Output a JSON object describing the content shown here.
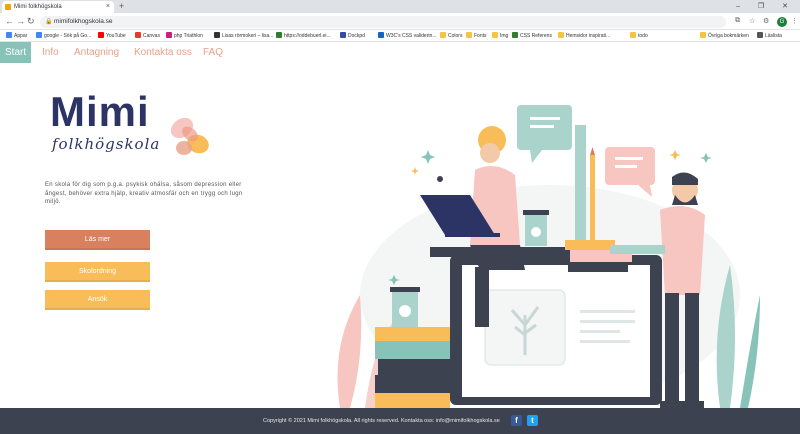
{
  "browser": {
    "tab_title": "Mimi folkhögskola",
    "tab_close": "×",
    "new_tab": "+",
    "window_controls": "– ❐ ✕",
    "url": "mimifolkhogskola.se",
    "profile_initial": "G",
    "bookmarks": [
      {
        "label": "Appar",
        "color": "#4285f4"
      },
      {
        "label": "google - Sök på Go...",
        "color": "#4285f4"
      },
      {
        "label": "YouTube",
        "color": "#ff0000"
      },
      {
        "label": "Canvas",
        "color": "#e13f2b"
      },
      {
        "label": "php Triathlon",
        "color": "#c4227d"
      },
      {
        "label": "Lisas rörmokeri – lisa...",
        "color": "#333333"
      },
      {
        "label": "https://oddebuerl.ei...",
        "color": "#2e7d32"
      },
      {
        "label": "Dockpd",
        "color": "#3949ab"
      },
      {
        "label": "W3C's CSS validerin...",
        "color": "#1565c0"
      },
      {
        "label": "Colors",
        "color": "#f6c343"
      },
      {
        "label": "Fonts",
        "color": "#f6c343"
      },
      {
        "label": "Img",
        "color": "#f6c343"
      },
      {
        "label": "CSS Referens",
        "color": "#2e7d32"
      },
      {
        "label": "Hemsidor inspirati...",
        "color": "#f6c343"
      },
      {
        "label": "todo",
        "color": "#f6c343"
      },
      {
        "label": "Övriga bokmärken",
        "color": "#f6c343"
      },
      {
        "label": "Läslista",
        "color": "#555555"
      }
    ]
  },
  "nav": {
    "items": [
      "Start",
      "Info",
      "Antagning",
      "Kontakta oss",
      "FAQ"
    ]
  },
  "logo": {
    "title": "Mimi",
    "subtitle": "folkhögskola"
  },
  "intro": {
    "text": "En skola för dig som p.g.a. psykisk ohälsa, såsom depression eller ångest, behöver extra hjälp, kreativ atmosfär och en trygg och lugn miljö."
  },
  "buttons": {
    "read_more": "Läs mer",
    "school_rules": "Skolordning",
    "apply": "Ansök"
  },
  "footer": {
    "text": "Copyright © 2021 Mimi folkhögskola. All rights reserved. Kontakta oss: info@mimifolkhogskola.se",
    "facebook": "f",
    "twitter": "t"
  },
  "colors": {
    "teal": "#87c3b8",
    "navy": "#2c3466",
    "salmon": "#d9815f",
    "yellow": "#f8bd58",
    "pink": "#f7c6c0",
    "footer": "#3d4250"
  }
}
